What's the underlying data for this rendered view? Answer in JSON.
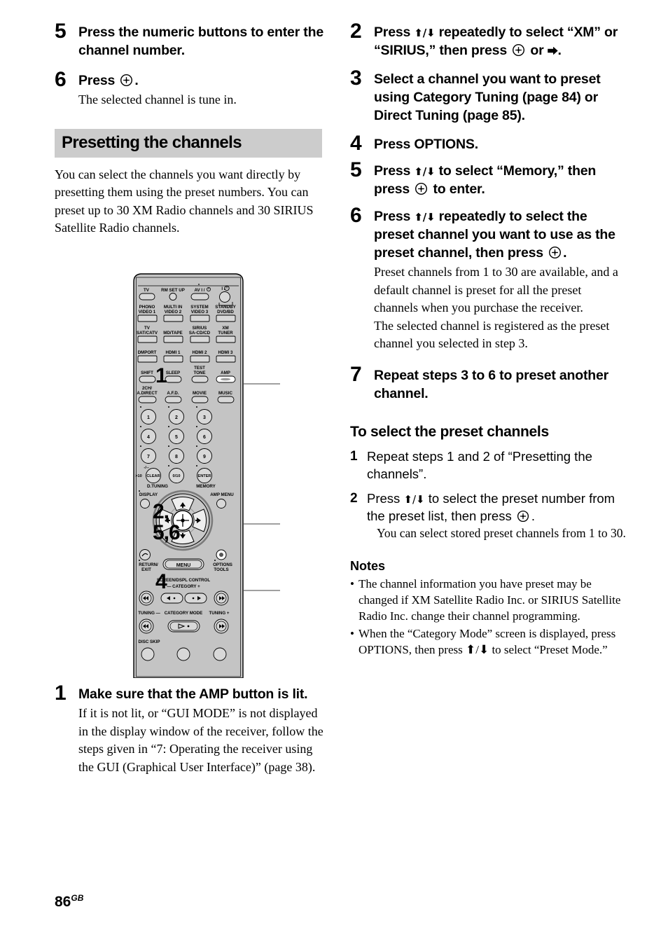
{
  "page": {
    "number": "86",
    "region_code": "GB"
  },
  "left_column": {
    "steps": [
      {
        "num": "5",
        "head": "Press the numeric buttons to enter the channel number.",
        "note": ""
      },
      {
        "num": "6",
        "head_before": "Press",
        "head_after": ".",
        "note": "The selected channel is tune in."
      }
    ],
    "section": {
      "title": "Presetting the channels",
      "paragraph": "You can select the channels you want directly by presetting them using the preset numbers. You can preset up to 30 XM Radio channels and 30 SIRIUS Satellite Radio channels."
    },
    "final_step": {
      "num": "1",
      "head": "Make sure that the AMP button is lit.",
      "note": "If it is not lit, or “GUI MODE” is not displayed in the display window of the receiver, follow the steps given in “7: Operating the receiver using the GUI (Graphical User Interface)” (page 38)."
    }
  },
  "remote": {
    "callouts": [
      {
        "id": "callout-1",
        "label": "1"
      },
      {
        "id": "callout-2",
        "label": "2,\n5,6"
      },
      {
        "id": "callout-4",
        "label": "4"
      }
    ],
    "top_row": [
      "TV",
      "RM SET UP",
      "AV I / ⏻",
      "I / ⏻"
    ],
    "input_rows": [
      [
        "PHONO",
        "MULTI IN",
        "SYSTEM",
        "STANDBY"
      ],
      [
        "VIDEO 1",
        "VIDEO 2",
        "VIDEO 3",
        "DVD/BD"
      ],
      [
        "TV",
        "",
        "SIRIUS",
        "XM"
      ],
      [
        "SAT/CATV",
        "MD/TAPE",
        "SA-CD/CD",
        "TUNER"
      ],
      [
        "DMPORT",
        "HDMI 1",
        "HDMI 2",
        "HDMI 3"
      ],
      [
        "",
        "",
        "TEST",
        ""
      ],
      [
        "SHIFT",
        "SLEEP",
        "TONE",
        "AMP"
      ],
      [
        "2CH/",
        "",
        "",
        ""
      ],
      [
        "A.DIRECT",
        "A.F.D.",
        "MOVIE",
        "MUSIC"
      ]
    ],
    "numeric_keys": [
      "1",
      "2",
      "3",
      "4",
      "5",
      "6",
      "7",
      "8",
      "9",
      ">10",
      "CLEAR",
      "0/10",
      "ENTER"
    ],
    "numeric_labels": {
      "d_tuning": "D.TUNING",
      "memory": "MEMORY",
      "plus_minus": "-/--"
    },
    "nav_labels": {
      "display": "DISPLAY",
      "amp_menu": "AMP MENU",
      "return_exit_1": "RETURN/",
      "return_exit_2": "EXIT",
      "menu": "MENU",
      "options_1": "OPTIONS",
      "options_2": "TOOLS"
    },
    "transport_labels": {
      "screen_dspl": "SCREEN/DSPL CONTROL",
      "category": "— CATEGORY  +",
      "tuning_minus": "TUNING —",
      "category_mode": "CATEGORY MODE",
      "tuning_plus": "TUNING +",
      "disc_skip": "DISC SKIP"
    }
  },
  "right_column": {
    "steps": [
      {
        "num": "2",
        "parts": [
          "Press ",
          "⬆/⬇",
          " repeatedly to select “XM” or “SIRIUS,” then press ",
          "ENTER_ICON",
          " or ",
          "⮕",
          "."
        ],
        "note": ""
      },
      {
        "num": "3",
        "head": "Select a channel you want to preset using Category Tuning (page 84) or Direct Tuning (page 85).",
        "note": ""
      },
      {
        "num": "4",
        "head": "Press OPTIONS.",
        "note": ""
      },
      {
        "num": "5",
        "head_a": "Press ",
        "head_b": " to select “Memory,” then press ",
        "head_c": " to enter.",
        "note": ""
      },
      {
        "num": "6",
        "head_a": "Press ",
        "head_b": " repeatedly to select the preset channel you want to use as the preset channel, then press ",
        "head_c": ".",
        "note": "Preset channels from 1 to 30 are available, and a default channel is preset for all the preset channels when you purchase the receiver.\nThe selected channel is registered as the preset channel you selected in step 3."
      },
      {
        "num": "7",
        "head": "Repeat steps 3 to 6 to preset another channel.",
        "note": ""
      }
    ],
    "sub_section": {
      "title": "To select the preset channels",
      "substeps": [
        {
          "num": "1",
          "head": "Repeat steps 1 and 2 of “Presetting the channels”.",
          "note": ""
        },
        {
          "num": "2",
          "head_a": "Press ",
          "head_b": " to select the preset number from the preset list, then press ",
          "head_c": ".",
          "note": "You can select stored preset channels from 1 to 30."
        }
      ]
    },
    "notes": {
      "title": "Notes",
      "items": [
        "The channel information you have preset may be changed if XM Satellite Radio Inc. or SIRIUS Satellite Radio Inc. change their channel programming.",
        "When the “Category Mode” screen is displayed, press OPTIONS, then press ⬆/⬇ to select “Preset Mode.”"
      ],
      "bullet": "•"
    }
  },
  "colors": {
    "section_bar": "#cccccc",
    "remote_body": "#c8c8c8",
    "callout_line": "#808080"
  }
}
